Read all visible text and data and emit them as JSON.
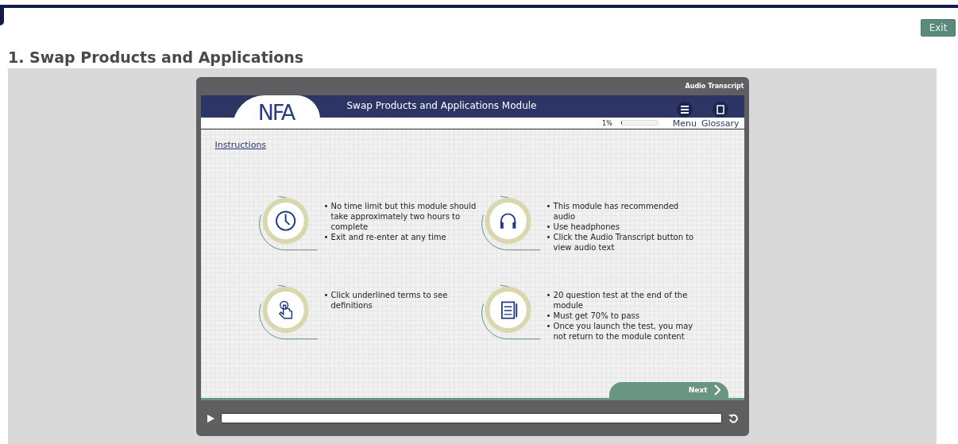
{
  "exit_button": "Exit",
  "page_title": "1. Swap Products and Applications",
  "player": {
    "audio_transcript": "Audio Transcript",
    "logo": "NFA",
    "module_title": "Swap Products and Applications Module",
    "progress": {
      "reading": "1%",
      "level": 0.01
    },
    "nav": [
      {
        "kind": "menu",
        "label": "Menu"
      },
      {
        "kind": "glossary",
        "label": "Glossary"
      }
    ],
    "section_link": "Instructions",
    "items": [
      {
        "kind": "clock",
        "bullets": [
          "• No time limit but this module should take approximately two hours to complete",
          "• Exit and re-enter at any time"
        ]
      },
      {
        "kind": "headphones",
        "bullets": [
          "• This module has recommended audio",
          "• Use headphones",
          "• Click the Audio Transcript button to view audio text"
        ]
      },
      {
        "kind": "touch",
        "bullets": [
          "• Click underlined terms to see definitions"
        ]
      },
      {
        "kind": "checklist",
        "bullets": [
          "• 20 question test at the end of the module",
          "• Must get 70% to pass",
          "• Once you launch the test, you may not return to the module content"
        ]
      }
    ],
    "next_button": "Next"
  }
}
